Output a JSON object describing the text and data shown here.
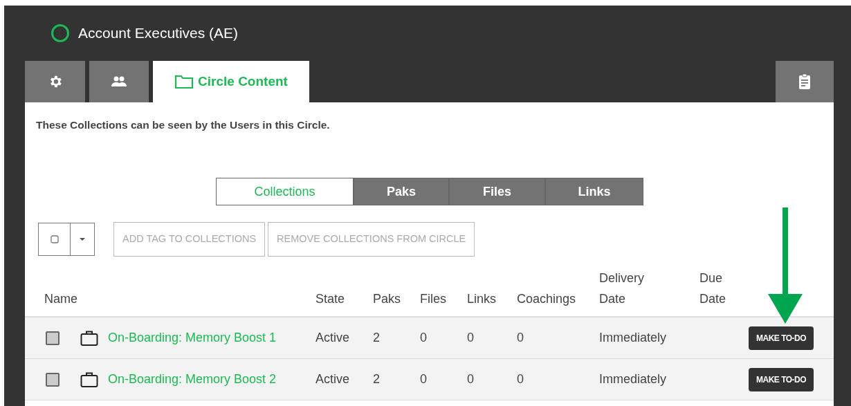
{
  "header": {
    "title": "Account Executives (AE)"
  },
  "tabs": [
    {
      "kind": "settings",
      "selected": false
    },
    {
      "kind": "users",
      "selected": false
    },
    {
      "kind": "folder",
      "label": "Circle Content",
      "selected": true
    }
  ],
  "side_tab": {
    "kind": "clipboard"
  },
  "description": "These Collections can be seen by the Users in this Circle.",
  "segments": [
    {
      "label": "Collections",
      "selected": true
    },
    {
      "label": "Paks",
      "selected": false
    },
    {
      "label": "Files",
      "selected": false
    },
    {
      "label": "Links",
      "selected": false
    }
  ],
  "toolbar": {
    "select_all": {
      "checked": false
    },
    "buttons": [
      {
        "label": "ADD TAG TO COLLECTIONS",
        "disabled": true
      },
      {
        "label": "REMOVE COLLECTIONS FROM CIRCLE",
        "disabled": true
      }
    ]
  },
  "table": {
    "columns": [
      "Name",
      "State",
      "Paks",
      "Files",
      "Links",
      "Coachings",
      "Delivery Date",
      "Due Date"
    ],
    "rows": [
      {
        "checked": false,
        "cells": [
          "On-Boarding: Memory Boost 1",
          "Active",
          "2",
          "0",
          "0",
          "0",
          "Immediately",
          ""
        ],
        "action": "MAKE TO-DO"
      },
      {
        "checked": false,
        "cells": [
          "On-Boarding: Memory Boost 2",
          "Active",
          "2",
          "0",
          "0",
          "0",
          "Immediately",
          ""
        ],
        "action": "MAKE TO-DO"
      }
    ]
  }
}
